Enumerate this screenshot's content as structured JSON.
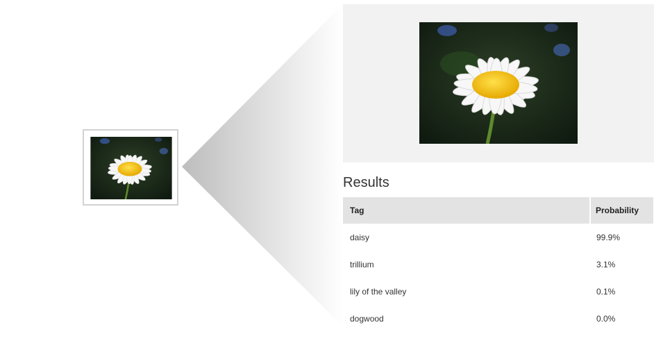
{
  "results": {
    "heading": "Results",
    "columns": {
      "tag": "Tag",
      "probability": "Probability"
    },
    "rows": [
      {
        "tag": "daisy",
        "probability": "99.9%"
      },
      {
        "tag": "trillium",
        "probability": "3.1%"
      },
      {
        "tag": "lily of the valley",
        "probability": "0.1%"
      },
      {
        "tag": "dogwood",
        "probability": "0.0%"
      }
    ]
  },
  "colors": {
    "panel_background": "#f2f2f2",
    "table_header_background": "#e3e3e3",
    "frame_border": "#d2d2d2",
    "petal": "#f7f7f7",
    "flower_center": "#f2c200",
    "photo_background": "#1d2e1c"
  }
}
